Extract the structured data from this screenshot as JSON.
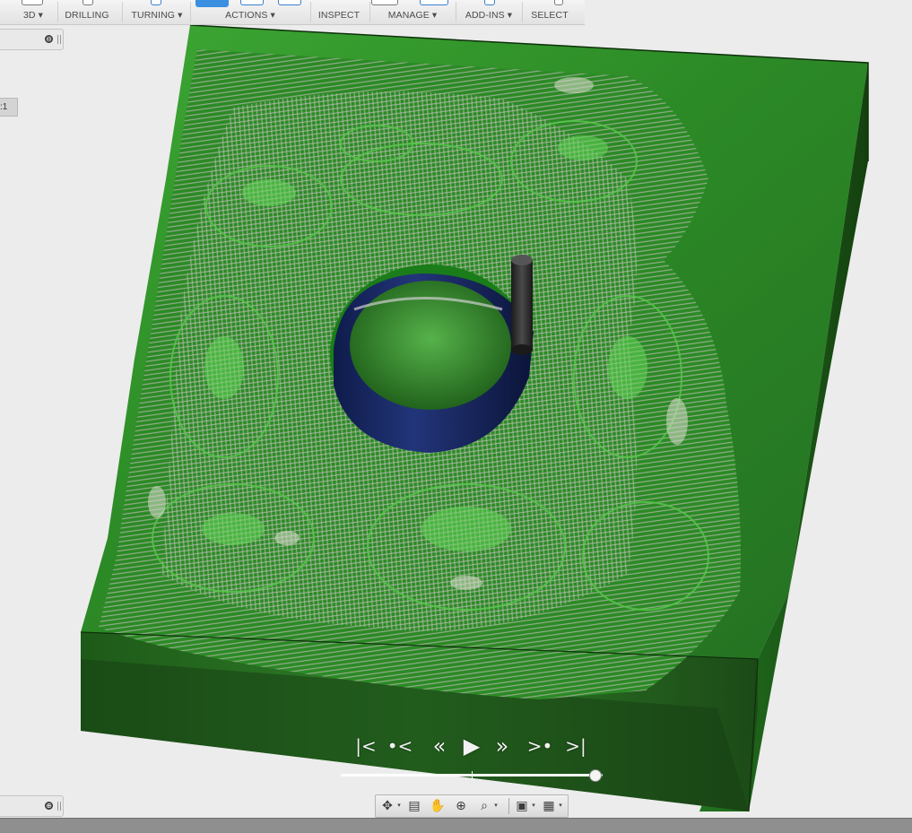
{
  "toolbar": {
    "groups": [
      {
        "label": "3D ▾"
      },
      {
        "label": "DRILLING"
      },
      {
        "label": "TURNING ▾"
      },
      {
        "label": "ACTIONS ▾"
      },
      {
        "label": "INSPECT"
      },
      {
        "label": "MANAGE ▾"
      },
      {
        "label": "ADD-INS ▾"
      },
      {
        "label": "SELECT"
      }
    ]
  },
  "left_panels": {
    "browser_collapse": "⊖",
    "scale_label": ":1",
    "comments_expand": "⊕"
  },
  "viewport": {
    "model": "toolpath-simulation-stock",
    "stock_color": "#2f8f2a",
    "stock_dark": "#1f4d1a",
    "hole_color": "#1b2a66",
    "tool_color": "#2a2a2a"
  },
  "player": {
    "buttons": [
      {
        "glyph": "|<",
        "name": "go-to-start"
      },
      {
        "glyph": "•<",
        "name": "previous-operation"
      },
      {
        "glyph": "«",
        "name": "step-back"
      },
      {
        "glyph": "▶",
        "name": "play"
      },
      {
        "glyph": "»",
        "name": "step-forward"
      },
      {
        "glyph": ">•",
        "name": "next-operation"
      },
      {
        "glyph": ">|",
        "name": "go-to-end"
      }
    ],
    "progress": 0.97
  },
  "navbar": {
    "orbit": "✥",
    "look_at": "▤",
    "pan": "✋",
    "zoom": "⊕",
    "zoom_window": "⌕",
    "display": "▣",
    "grid": "▦",
    "caret": "▾"
  }
}
